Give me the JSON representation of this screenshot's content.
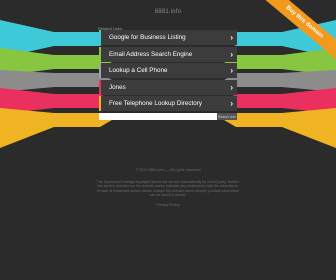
{
  "header": {
    "site_title": "8881.info",
    "sponsored_label": "Related Links"
  },
  "ribbon": {
    "label": "Buy this domain",
    "color": "#f39a1e"
  },
  "links": [
    {
      "label": "Google for Business Listing",
      "color": "#3ec9d9"
    },
    {
      "label": "Email Address Search Engine",
      "color": "#88c540"
    },
    {
      "label": "Lookup a Cell Phone",
      "color": "#a4a4a4"
    },
    {
      "label": "Jones",
      "color": "#e9305f"
    },
    {
      "label": "Free Telephone Lookup Directory",
      "color": "#f0b322"
    }
  ],
  "search": {
    "placeholder": "",
    "button_label": "Search Ads"
  },
  "footer": {
    "copyright": "© 2024 8881.info — All rights reserved",
    "disclaimer": "The Sponsored Listings displayed above are served automatically by a third party. Neither the service provider nor the domain owner maintain any relationship with the advertisers. In case of trademark issues please contact the domain owner directly (contact information can be found in whois).",
    "privacy": "Privacy Policy"
  },
  "stripe_colors": [
    "#3ec9d9",
    "#88c540",
    "#8c8c8c",
    "#e9305f",
    "#f0b322"
  ]
}
